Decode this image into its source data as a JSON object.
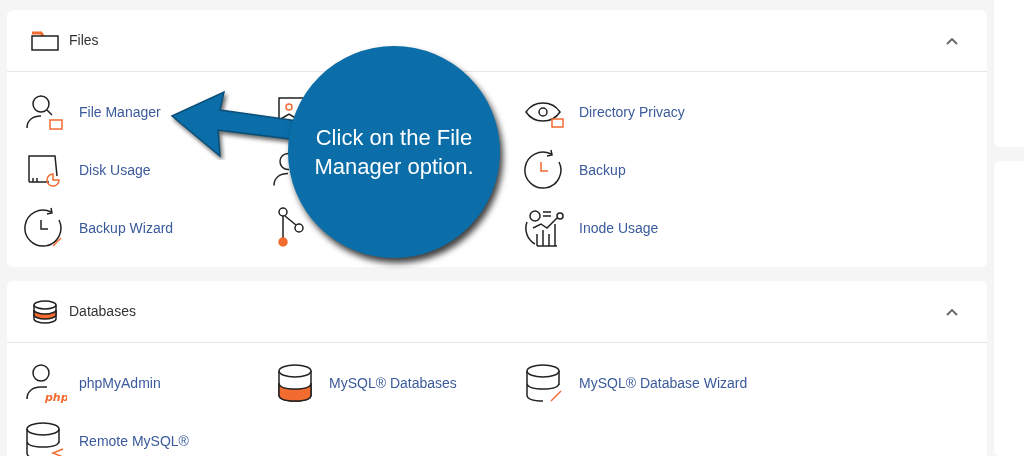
{
  "sections": [
    {
      "title": "Files",
      "expanded": true,
      "items": [
        {
          "kind": "tool",
          "label": "File Manager"
        },
        {
          "kind": "covered"
        },
        {
          "kind": "tool",
          "label": "Directory Privacy"
        },
        {
          "kind": "tool",
          "label": "Disk Usage"
        },
        {
          "kind": "covered"
        },
        {
          "kind": "tool",
          "label": "Backup"
        },
        {
          "kind": "tool",
          "label": "Backup Wizard"
        },
        {
          "kind": "covered"
        },
        {
          "kind": "tool",
          "label": "Inode Usage"
        }
      ]
    },
    {
      "title": "Databases",
      "expanded": true,
      "items": [
        {
          "kind": "tool",
          "label": "phpMyAdmin",
          "icon_text": "php"
        },
        {
          "kind": "tool",
          "label": "MySQL® Databases"
        },
        {
          "kind": "tool",
          "label": "MySQL® Database Wizard"
        },
        {
          "kind": "tool",
          "label": "Remote MySQL®"
        }
      ]
    }
  ],
  "callout": {
    "text": "Click on the File Manager option."
  }
}
